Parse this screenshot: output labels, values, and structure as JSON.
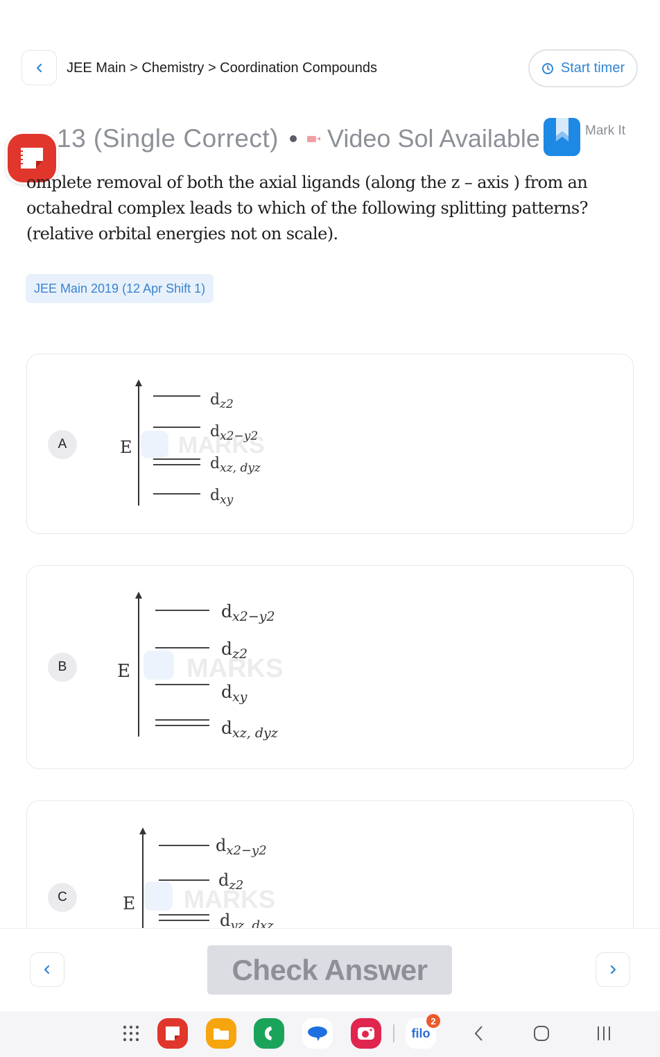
{
  "header": {
    "back_icon": "chevron-left-icon",
    "breadcrumb": [
      "JEE Main",
      "Chemistry",
      "Coordination Compounds"
    ],
    "breadcrumb_separator": " > ",
    "breadcrumb_text": "JEE Main > Chemistry > Coordination Compounds",
    "timer_button_label": "Start timer",
    "timer_icon": "clock-icon"
  },
  "question_header": {
    "number_label": "Q13 (Single Correct)",
    "visible_number_label": "13 (Single Correct)",
    "video_label": "Video Sol Available",
    "video_icon": "video-camera-icon",
    "mark_label": "Mark It",
    "mark_icon": "bookmark-icon"
  },
  "question": {
    "text": "Complete removal of both the axial ligands (along the z – axis ) from an octahedral complex leads to which of the following splitting patterns? (relative orbital energies not on scale).",
    "visible_text": "omplete removal of both the axial ligands (along the z – axis ) from an octahedral complex leads to which of the following splitting patterns? (relative orbital energies not on scale).",
    "tag": "JEE Main 2019 (12 Apr Shift 1)"
  },
  "options": [
    {
      "letter": "A",
      "axis_label": "E",
      "watermark": "MARKS",
      "levels": [
        {
          "base": "d",
          "sub": "z2",
          "degenerate": false
        },
        {
          "base": "d",
          "sub": "x2−y2",
          "degenerate": false
        },
        {
          "base": "d",
          "sub": "xz, dyz",
          "label": "dxz, dyz",
          "degenerate": true
        },
        {
          "base": "d",
          "sub": "xy",
          "degenerate": false
        }
      ]
    },
    {
      "letter": "B",
      "axis_label": "E",
      "watermark": "MARKS",
      "levels": [
        {
          "base": "d",
          "sub": "x2−y2",
          "degenerate": false
        },
        {
          "base": "d",
          "sub": "z2",
          "degenerate": false
        },
        {
          "base": "d",
          "sub": "xy",
          "degenerate": false
        },
        {
          "base": "d",
          "sub": "xz, dyz",
          "label": "dxz, dyz",
          "degenerate": true
        }
      ]
    },
    {
      "letter": "C",
      "axis_label": "E",
      "watermark": "MARKS",
      "levels": [
        {
          "base": "d",
          "sub": "x2−y2",
          "degenerate": false
        },
        {
          "base": "d",
          "sub": "z2",
          "degenerate": false
        },
        {
          "base": "d",
          "sub": "yz, dxz",
          "label": "dyz, dxz",
          "degenerate": true
        }
      ]
    }
  ],
  "footer": {
    "prev_icon": "chevron-left-icon",
    "next_icon": "chevron-right-icon",
    "check_answer_label": "Check Answer"
  },
  "taskbar": {
    "apps": [
      {
        "name": "app-drawer",
        "icon": "grid-icon"
      },
      {
        "name": "notes",
        "icon": "notes-icon",
        "color": "#e0362c"
      },
      {
        "name": "files",
        "icon": "folder-icon",
        "color": "#f6a50f"
      },
      {
        "name": "phone",
        "icon": "phone-icon",
        "color": "#1aa45a"
      },
      {
        "name": "messages",
        "icon": "chat-bubble-icon",
        "color": "#1e6fe0"
      },
      {
        "name": "camera",
        "icon": "camera-icon",
        "color": "#e0264f"
      },
      {
        "name": "filo",
        "label": "filo",
        "badge": "2"
      }
    ],
    "nav": [
      "back",
      "home",
      "recents"
    ]
  },
  "colors": {
    "accent": "#2f86d6",
    "tag_bg": "#e8f1fb",
    "check_bg": "#dcdde2",
    "check_text": "#8e9098",
    "mark_blue": "#1e88e5"
  }
}
